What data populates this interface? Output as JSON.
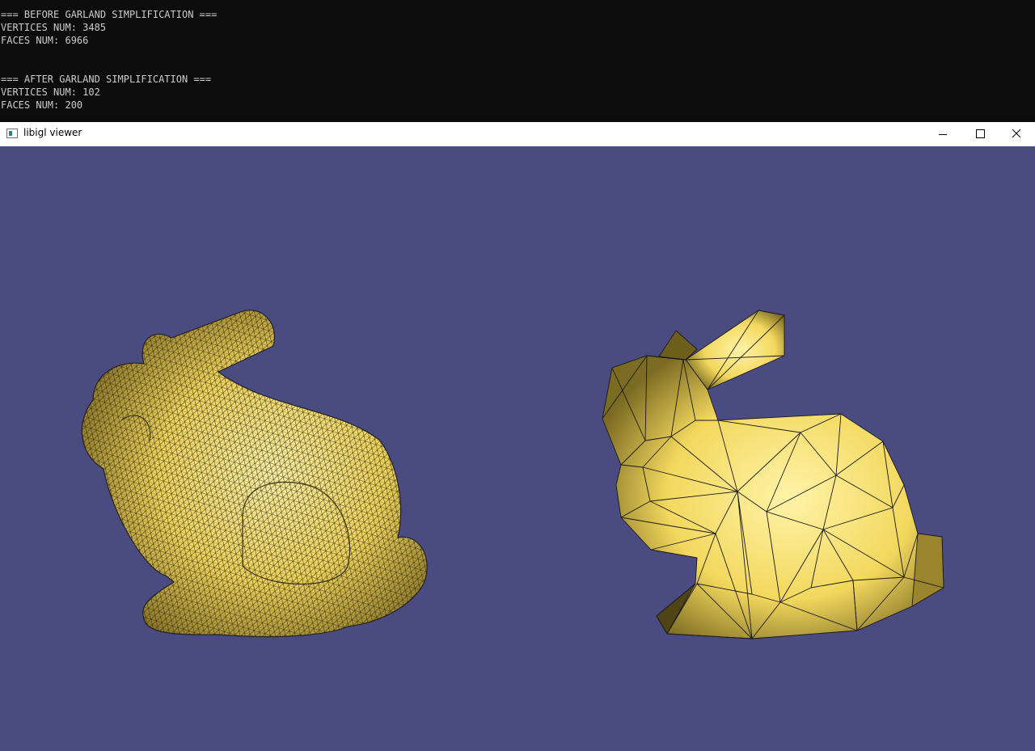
{
  "console": {
    "lines": [
      "=== BEFORE GARLAND SIMPLIFICATION ===",
      "VERTICES NUM: 3485",
      "FACES NUM: 6966",
      "",
      "",
      "=== AFTER GARLAND SIMPLIFICATION ===",
      "VERTICES NUM: 102",
      "FACES NUM: 200"
    ]
  },
  "window": {
    "title": "libigl viewer",
    "controls": {
      "minimize_icon": "minimize-icon",
      "maximize_icon": "maximize-icon",
      "close_icon": "close-icon"
    }
  },
  "viewport": {
    "background_color": "#4a4b80",
    "mesh_color": "#f1d75a",
    "wire_color": "#1a1a1a",
    "meshes": [
      {
        "name": "original-bunny",
        "vertices": 3485,
        "faces": 6966
      },
      {
        "name": "simplified-bunny",
        "vertices": 102,
        "faces": 200
      }
    ]
  }
}
